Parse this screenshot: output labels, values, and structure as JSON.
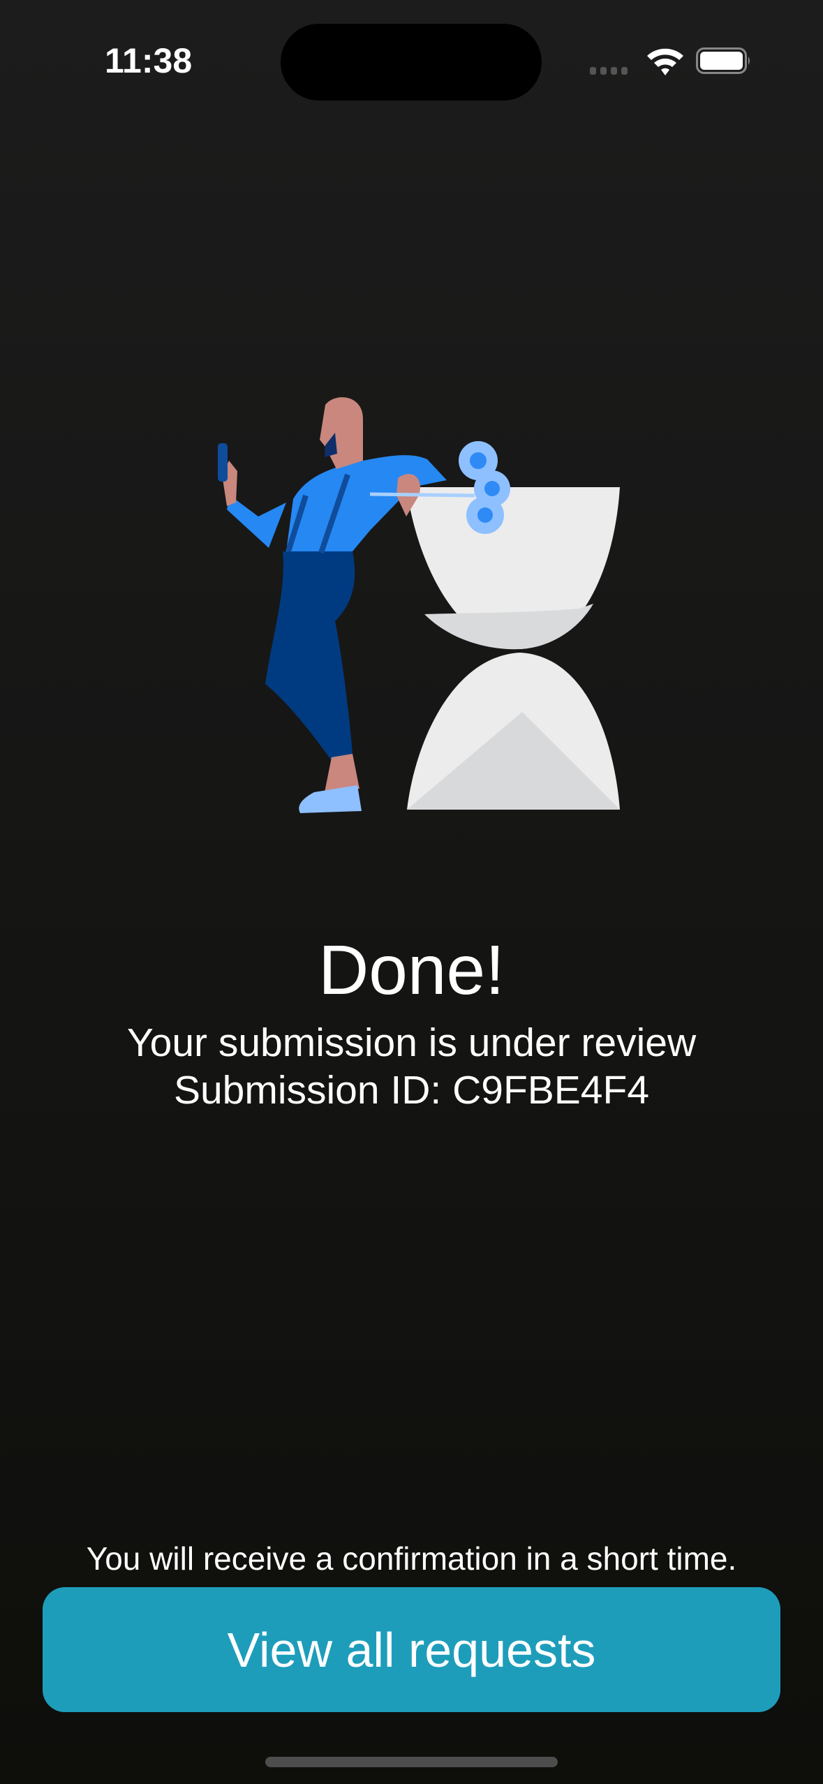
{
  "status_bar": {
    "time": "11:38"
  },
  "main": {
    "title": "Done!",
    "subtitle": "Your submission is under review",
    "submission_id_line": "Submission ID: C9FBE4F4",
    "note": "You will receive a confirmation in a short time.",
    "button_label": "View all requests"
  },
  "colors": {
    "accent": "#1e9dbb",
    "background": "#151514"
  }
}
